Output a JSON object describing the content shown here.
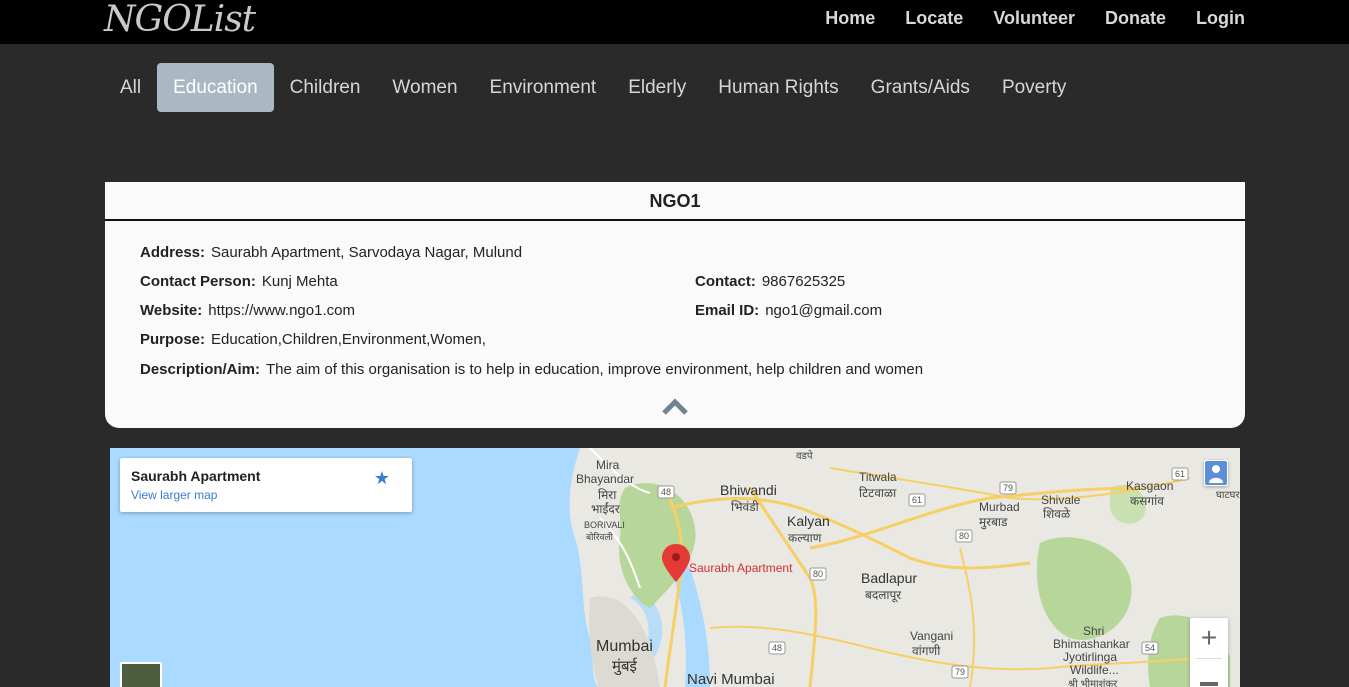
{
  "brand": "NGOList",
  "nav": [
    "Home",
    "Locate",
    "Volunteer",
    "Donate",
    "Login"
  ],
  "categories": [
    "All",
    "Education",
    "Children",
    "Women",
    "Environment",
    "Elderly",
    "Human Rights",
    "Grants/Aids",
    "Poverty"
  ],
  "active_category": "Education",
  "ngo": {
    "title": "NGO1",
    "address_label": "Address:",
    "address": "Saurabh Apartment, Sarvodaya Nagar, Mulund",
    "contact_person_label": "Contact Person:",
    "contact_person": "Kunj Mehta",
    "contact_label": "Contact:",
    "contact": "9867625325",
    "website_label": "Website:",
    "website": "https://www.ngo1.com",
    "email_label": "Email ID:",
    "email": "ngo1@gmail.com",
    "purpose_label": "Purpose:",
    "purpose": "Education,Children,Environment,Women,",
    "description_label": "Description/Aim:",
    "description": "The aim of this organisation is to help in education, improve environment, help children and women"
  },
  "map": {
    "place_title": "Saurabh Apartment",
    "view_larger": "View larger map",
    "marker_label": "Saurabh Apartment",
    "labels": {
      "mira": "Mira",
      "bhayandar": "Bhayandar",
      "mira_dev": "मिरा",
      "bhayandar_dev": "भाईंदर",
      "borivali": "BORIVALI",
      "borivali_dev": "बोरिवली",
      "bhiwandi": "Bhiwandi",
      "bhiwandi_dev": "भिवंडी",
      "kalyan": "Kalyan",
      "kalyan_dev": "कल्याण",
      "titwala": "Titwala",
      "titwala_dev": "टिटवाळा",
      "murbad": "Murbad",
      "murbad_dev": "मुरबाड",
      "shivale": "Shivale",
      "shivale_dev": "शिवळे",
      "kasgaon": "Kasgaon",
      "kasgaon_dev": "कसगांव",
      "badlapur": "Badlapur",
      "badlapur_dev": "बदलापूर",
      "vangani": "Vangani",
      "vangani_dev": "वांगणी",
      "mumbai": "Mumbai",
      "mumbai_dev": "मुंबई",
      "navi_mumbai": "Navi Mumbai",
      "shri": "Shri",
      "bhimashankar": "Bhimashankar",
      "jyotirlinga": "Jyotirlinga",
      "wildlife": "Wildlife...",
      "bhimashankar_dev": "श्री भीमाशंकर",
      "vadpe_dev": "वडपे",
      "ghatghar_dev": "घाटघर"
    },
    "highway_shields": [
      "48",
      "61",
      "79",
      "80",
      "80",
      "48",
      "79",
      "54",
      "61"
    ],
    "colors": {
      "water": "#aadaff",
      "land": "#e9e8e2",
      "forest": "#b7d79a",
      "highway": "#f6cf65",
      "marker": "#e53935"
    }
  },
  "colors": {
    "navbar": "#000000",
    "page_bg": "#2a2a2a",
    "active_pill": "#aab8c2",
    "card_bg": "#fafafa"
  }
}
